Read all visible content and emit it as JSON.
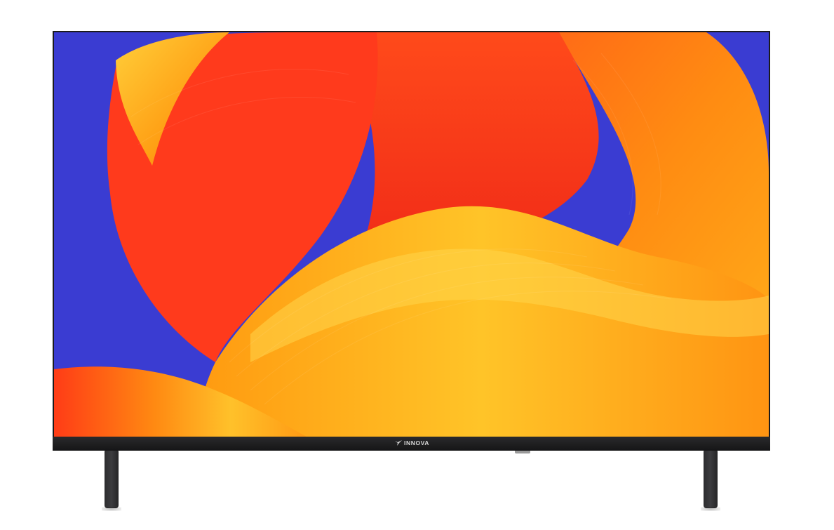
{
  "product": {
    "brand_logo_text": "INNOVA"
  },
  "colors": {
    "bezel": "#1b1b1d",
    "screen_background": "#3a3cd2",
    "wallpaper_primary": "#ff3a1c",
    "wallpaper_secondary": "#ffa312",
    "wallpaper_highlight": "#ffd84a"
  }
}
